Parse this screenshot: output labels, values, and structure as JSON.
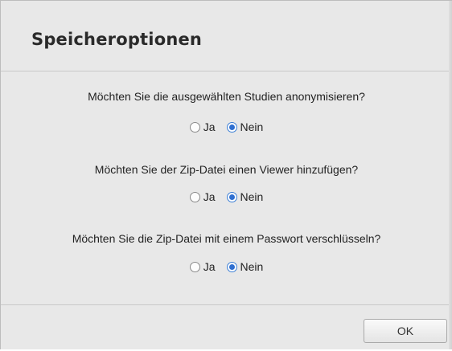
{
  "dialog": {
    "title": "Speicheroptionen"
  },
  "questions": [
    {
      "text": "Möchten Sie die ausgewählten Studien anonymisieren?",
      "options": [
        {
          "label": "Ja",
          "checked": false
        },
        {
          "label": "Nein",
          "checked": true
        }
      ]
    },
    {
      "text": "Möchten Sie der Zip-Datei einen Viewer hinzufügen?",
      "options": [
        {
          "label": "Ja",
          "checked": false
        },
        {
          "label": "Nein",
          "checked": true
        }
      ]
    },
    {
      "text": "Möchten Sie die Zip-Datei mit einem Passwort verschlüsseln?",
      "options": [
        {
          "label": "Ja",
          "checked": false
        },
        {
          "label": "Nein",
          "checked": true
        }
      ]
    }
  ],
  "footer": {
    "ok_label": "OK"
  },
  "colors": {
    "accent": "#2f6fd0",
    "dialog_bg": "#e8e8e8"
  }
}
